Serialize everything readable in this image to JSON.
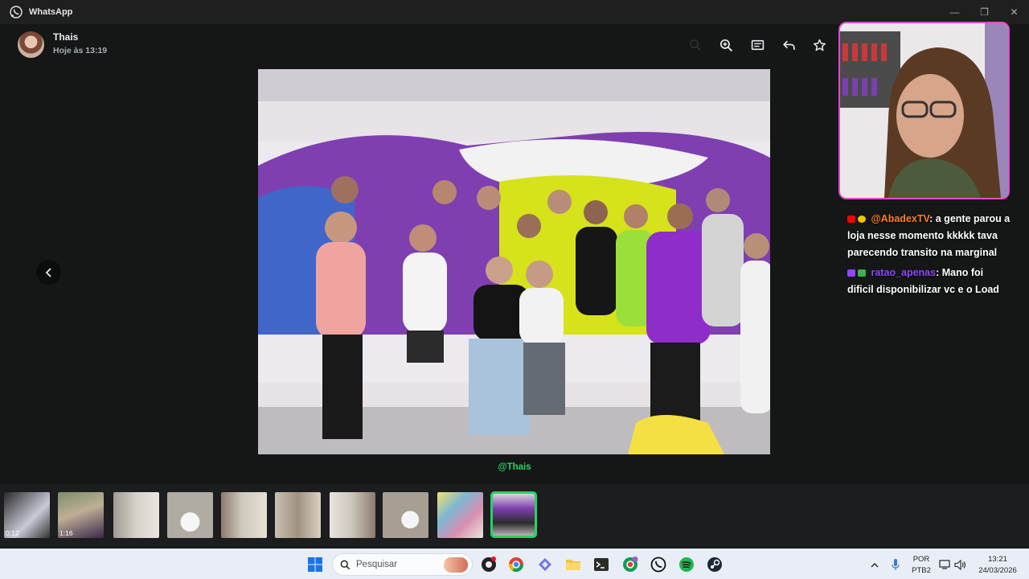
{
  "window": {
    "app_name": "WhatsApp"
  },
  "header": {
    "contact_name": "Thais",
    "timestamp": "Hoje às 13:19",
    "actions": [
      "search-icon",
      "zoom-in-icon",
      "go-to-message-icon",
      "reply-icon",
      "star-icon"
    ]
  },
  "viewer": {
    "caption": "@Thais"
  },
  "thumbnails": [
    {
      "type": "video",
      "duration": "0:12"
    },
    {
      "type": "video",
      "duration": "1:16"
    },
    {
      "type": "image"
    },
    {
      "type": "image"
    },
    {
      "type": "image"
    },
    {
      "type": "image"
    },
    {
      "type": "image"
    },
    {
      "type": "image"
    },
    {
      "type": "image"
    },
    {
      "type": "image",
      "selected": true
    }
  ],
  "stream_chat": [
    {
      "user": "@AbadexTV",
      "text": ": a gente parou a loja nesse momento kkkkk tava parecendo transito na marginal",
      "color": "#ff7f24"
    },
    {
      "user": "ratao_apenas",
      "text": ": Mano foi dificil disponibilizar vc e o Load",
      "color": "#9146ff"
    }
  ],
  "taskbar": {
    "search_placeholder": "Pesquisar",
    "language": "POR",
    "layout": "PTB2",
    "time": "13:21",
    "date": "24/03/2026"
  },
  "colors": {
    "accent": "#25d366",
    "cam_border": "#e24bc8"
  }
}
